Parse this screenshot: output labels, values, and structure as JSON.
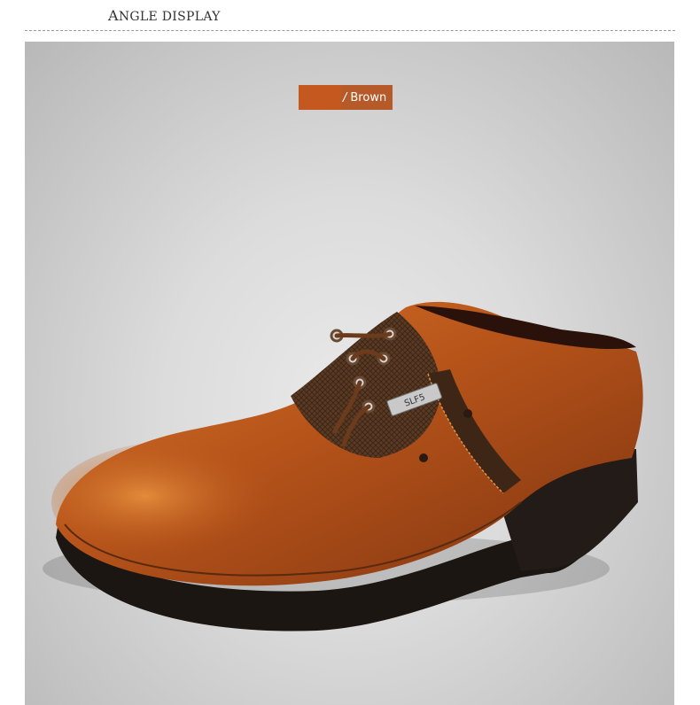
{
  "header": {
    "title_initial": "A",
    "title_rest": "NGLE DISPLAY"
  },
  "badge": {
    "slash": "/",
    "label": "Brown",
    "swatch_color": "#c4581e",
    "background_color": "#b65a2a"
  },
  "product": {
    "depicted": "brown leather lace-up oxford shoe",
    "logo_text": "SLF5"
  }
}
